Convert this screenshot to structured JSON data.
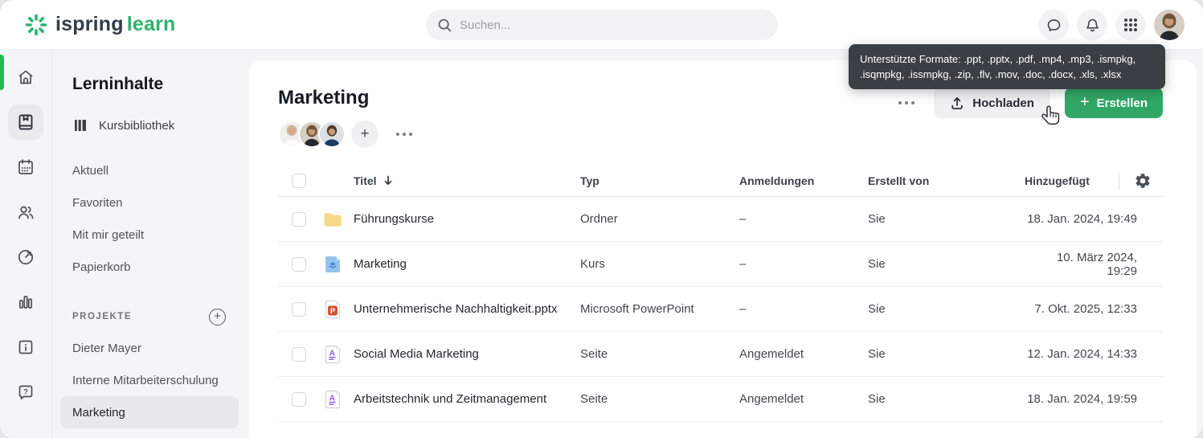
{
  "topbar": {
    "logo_text": "ispring",
    "logo_accent": "learn",
    "search_placeholder": "Suchen..."
  },
  "tooltip_text": "Unterstützte Formate: .ppt, .pptx, .pdf, .mp4, .mp3, .ismpkg, .isqmpkg, .issmpkg, .zip, .flv, .mov, .doc, .docx, .xls, .xlsx",
  "sidebar": {
    "title": "Lerninhalte",
    "library_label": "Kursbibliothek",
    "items": [
      {
        "label": "Aktuell"
      },
      {
        "label": "Favoriten"
      },
      {
        "label": "Mit mir geteilt"
      },
      {
        "label": "Papierkorb"
      }
    ],
    "projects_header": "PROJEKTE",
    "projects": [
      {
        "label": "Dieter Mayer"
      },
      {
        "label": "Interne Mitarbeiterschulung"
      },
      {
        "label": "Marketing",
        "selected": true
      }
    ]
  },
  "main": {
    "title": "Marketing",
    "upload_label": "Hochladen",
    "create_label": "Erstellen",
    "table": {
      "headers": {
        "title": "Titel",
        "type": "Typ",
        "enrollments": "Anmeldungen",
        "created_by": "Erstellt von",
        "added": "Hinzugefügt"
      },
      "rows": [
        {
          "icon": "folder-icon",
          "title": "Führungskurse",
          "type": "Ordner",
          "enrollments": "–",
          "created_by": "Sie",
          "added": "18. Jan. 2024, 19:49"
        },
        {
          "icon": "course-icon",
          "title": "Marketing",
          "type": "Kurs",
          "enrollments": "–",
          "created_by": "Sie",
          "added": "10. März 2024, 19:29"
        },
        {
          "icon": "powerpoint-icon",
          "title": "Unternehmerische Nachhaltigkeit.pptx",
          "type": "Microsoft PowerPoint",
          "enrollments": "–",
          "created_by": "Sie",
          "added": "7. Okt. 2025, 12:33"
        },
        {
          "icon": "page-icon",
          "title": "Social Media Marketing",
          "type": "Seite",
          "enrollments": "Angemeldet",
          "created_by": "Sie",
          "added": "12. Jan. 2024, 14:33"
        },
        {
          "icon": "page-icon",
          "title": "Arbeitstechnik und Zeitmanagement",
          "type": "Seite",
          "enrollments": "Angemeldet",
          "created_by": "Sie",
          "added": "18. Jan. 2024, 19:59"
        }
      ]
    }
  },
  "colors": {
    "brand_green": "#31a767",
    "logo_green": "#2fb26c",
    "selected_indicator": "#22ba5b",
    "tooltip_bg": "#3a3f45",
    "folder_yellow": "#f6d98a",
    "course_blue": "#94c4f0",
    "powerpoint_red": "#d35230",
    "page_purple": "#8b5cf6"
  }
}
